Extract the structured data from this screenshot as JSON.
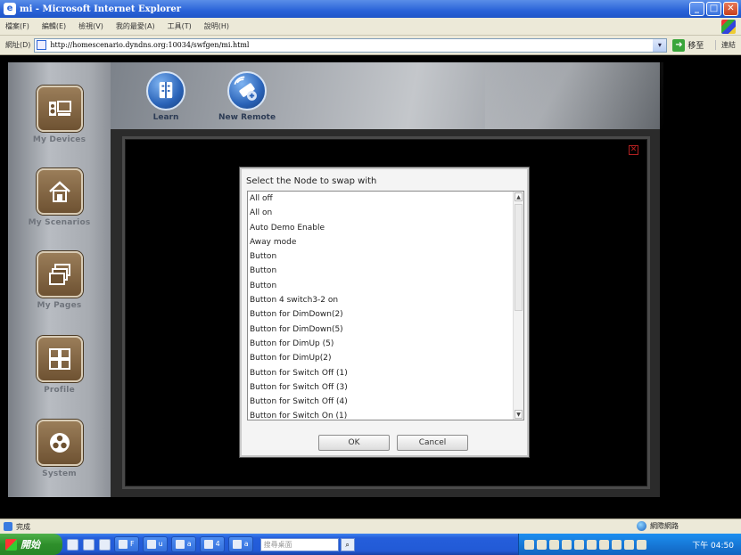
{
  "browser": {
    "window_title": "mi - Microsoft Internet Explorer",
    "menu": [
      "檔案(F)",
      "編輯(E)",
      "檢視(V)",
      "我的最愛(A)",
      "工具(T)",
      "說明(H)"
    ],
    "address_label": "網址(D)",
    "url": "http://homescenario.dyndns.org:10034/swfgen/mi.html",
    "go_label": "移至",
    "links_label": "連結",
    "status_text": "完成",
    "zone_text": "網際網路"
  },
  "sidebar": {
    "items": [
      {
        "label": "My Devices",
        "icon": "devices-icon"
      },
      {
        "label": "My Scenarios",
        "icon": "house-icon"
      },
      {
        "label": "My Pages",
        "icon": "pages-icon"
      },
      {
        "label": "Profile",
        "icon": "grid-icon"
      },
      {
        "label": "System",
        "icon": "system-icon"
      }
    ]
  },
  "toolbar": {
    "learn_label": "Learn",
    "new_remote_label": "New Remote"
  },
  "dialog": {
    "title": "Select the Node to swap with",
    "items": [
      "All off",
      "All on",
      "Auto Demo Enable",
      "Away mode",
      "Button",
      "Button",
      "Button",
      "Button 4 switch3-2 on",
      "Button for DimDown(2)",
      "Button for DimDown(5)",
      "Button for DimUp (5)",
      "Button for DimUp(2)",
      "Button for Switch Off (1)",
      "Button for Switch Off (3)",
      "Button for Switch Off (4)",
      "Button for Switch On (1)"
    ],
    "ok_label": "OK",
    "cancel_label": "Cancel"
  },
  "taskbar": {
    "start_label": "開始",
    "tasks": [
      "F",
      "u",
      "a",
      "4",
      "a"
    ],
    "search_placeholder": "搜尋桌面",
    "clock": "下午 04:50"
  }
}
